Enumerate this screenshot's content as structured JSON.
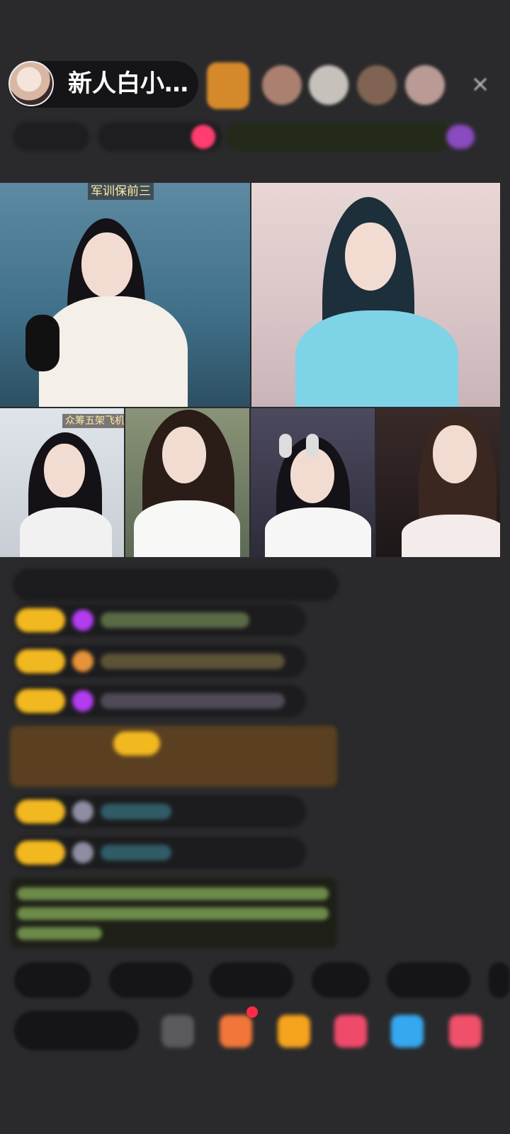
{
  "header": {
    "host_name": "新人白小…",
    "host_avatar_icon": "host-avatar",
    "close_icon": "close-icon"
  },
  "videos": {
    "tile1_label": "军训保前三",
    "tile3_label": "众筹五架飞机过日仑"
  },
  "colors": {
    "badge": "#f2b820",
    "background": "#2a2a2c",
    "highlight_chat": "#5a4020"
  }
}
